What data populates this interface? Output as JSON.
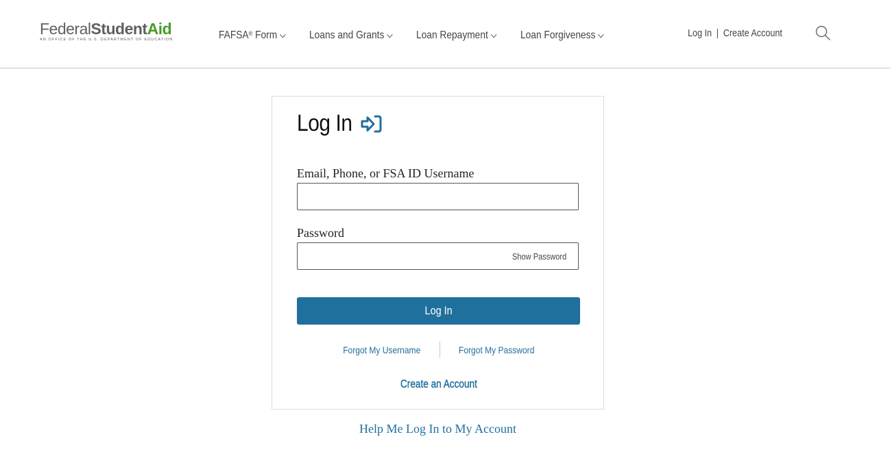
{
  "header": {
    "logo": {
      "word1": "Federal",
      "word2": "Student",
      "word3": "Aid",
      "tagline": "An Office of the U.S. Department of Education"
    },
    "nav": [
      {
        "label": "FAFSA",
        "sup": "®",
        "suffix": " Form",
        "icon": "chevron-down-icon"
      },
      {
        "label": "Loans and Grants",
        "icon": "chevron-down-icon"
      },
      {
        "label": "Loan Repayment",
        "icon": "chevron-down-icon"
      },
      {
        "label": "Loan Forgiveness",
        "icon": "chevron-down-icon"
      }
    ],
    "utility": {
      "login": "Log In",
      "separator": "|",
      "create_account": "Create Account"
    },
    "search_icon": "search-icon"
  },
  "login_card": {
    "title": "Log In",
    "title_icon": "sign-in-arrow-icon",
    "username_label": "Email, Phone, or FSA ID Username",
    "username_value": "",
    "password_label": "Password",
    "password_value": "",
    "show_password": "Show Password",
    "submit": "Log In",
    "forgot_username": "Forgot My Username",
    "forgot_password": "Forgot My Password",
    "create_account": "Create an Account"
  },
  "help_link": "Help Me Log In to My Account",
  "colors": {
    "brand_blue": "#20709e",
    "logo_green": "#4a9a2a",
    "logo_gray": "#5f6062"
  }
}
